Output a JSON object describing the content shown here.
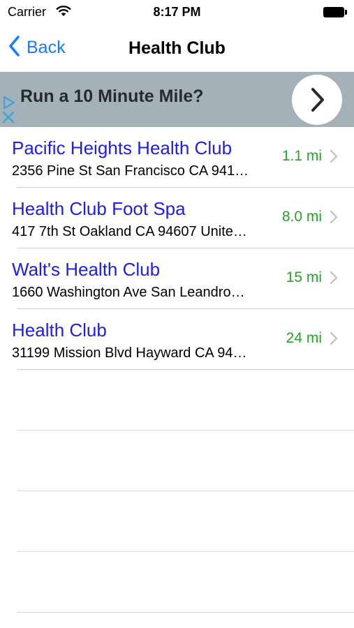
{
  "status_bar": {
    "carrier": "Carrier",
    "time": "8:17 PM",
    "battery_level": 1.0
  },
  "nav": {
    "back_label": "Back",
    "title": "Health Club"
  },
  "ad": {
    "text": "Run a 10 Minute Mile?",
    "adchoices_icon": "adchoices-triangle-icon",
    "close_icon": "close-x-icon",
    "cta_icon": "chevron-right-icon"
  },
  "results": [
    {
      "name": "Pacific Heights Health Club",
      "address": "2356 Pine St San Francisco CA 941…",
      "distance": "1.1 mi"
    },
    {
      "name": "Health Club Foot Spa",
      "address": "417 7th St Oakland CA 94607 Unite…",
      "distance": "8.0 mi"
    },
    {
      "name": "Walt's Health Club",
      "address": "1660 Washington Ave San Leandro…",
      "distance": "15 mi"
    },
    {
      "name": "Health Club",
      "address": "31199 Mission Blvd Hayward CA 94…",
      "distance": "24 mi"
    }
  ],
  "colors": {
    "link": "#1a7cf6",
    "title": "#1e1ee6",
    "distance": "#22a722",
    "ad_bg": "#a4b1b9"
  }
}
